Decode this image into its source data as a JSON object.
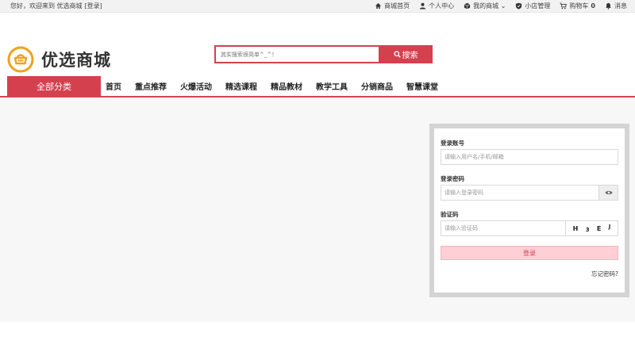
{
  "topbar": {
    "greeting": "您好，欢迎来到 优选商城",
    "login_link": "[登录]",
    "links": [
      {
        "icon": "home-icon",
        "label": "商城首页"
      },
      {
        "icon": "user-icon",
        "label": "个人中心"
      },
      {
        "icon": "box-icon",
        "label": "我的商城 ⌄"
      },
      {
        "icon": "shield-icon",
        "label": "小店管理"
      },
      {
        "icon": "cart-icon",
        "label": "购物车"
      },
      {
        "icon": "bell-icon",
        "label": "消息"
      }
    ],
    "cart_count": "0"
  },
  "brand": {
    "name": "优选商城",
    "accent": "#d5404f",
    "logo_color": "#f0a11d"
  },
  "search": {
    "placeholder": "其实搜索很简单^_^！",
    "button_label": "搜索"
  },
  "nav": {
    "all_categories": "全部分类",
    "items": [
      "首页",
      "重点推荐",
      "火爆活动",
      "精选课程",
      "精品教材",
      "教学工具",
      "分销商品",
      "智慧课堂"
    ]
  },
  "login": {
    "account_label": "登录账号",
    "account_placeholder": "请输入用户名/手机/邮箱",
    "password_label": "登录密码",
    "password_placeholder": "请输入登录密码",
    "captcha_label": "验证码",
    "captcha_placeholder": "请输入验证码",
    "captcha_chars": [
      "H",
      "3",
      "E",
      "J"
    ],
    "submit_label": "登录",
    "forgot_label": "忘记密码?"
  }
}
